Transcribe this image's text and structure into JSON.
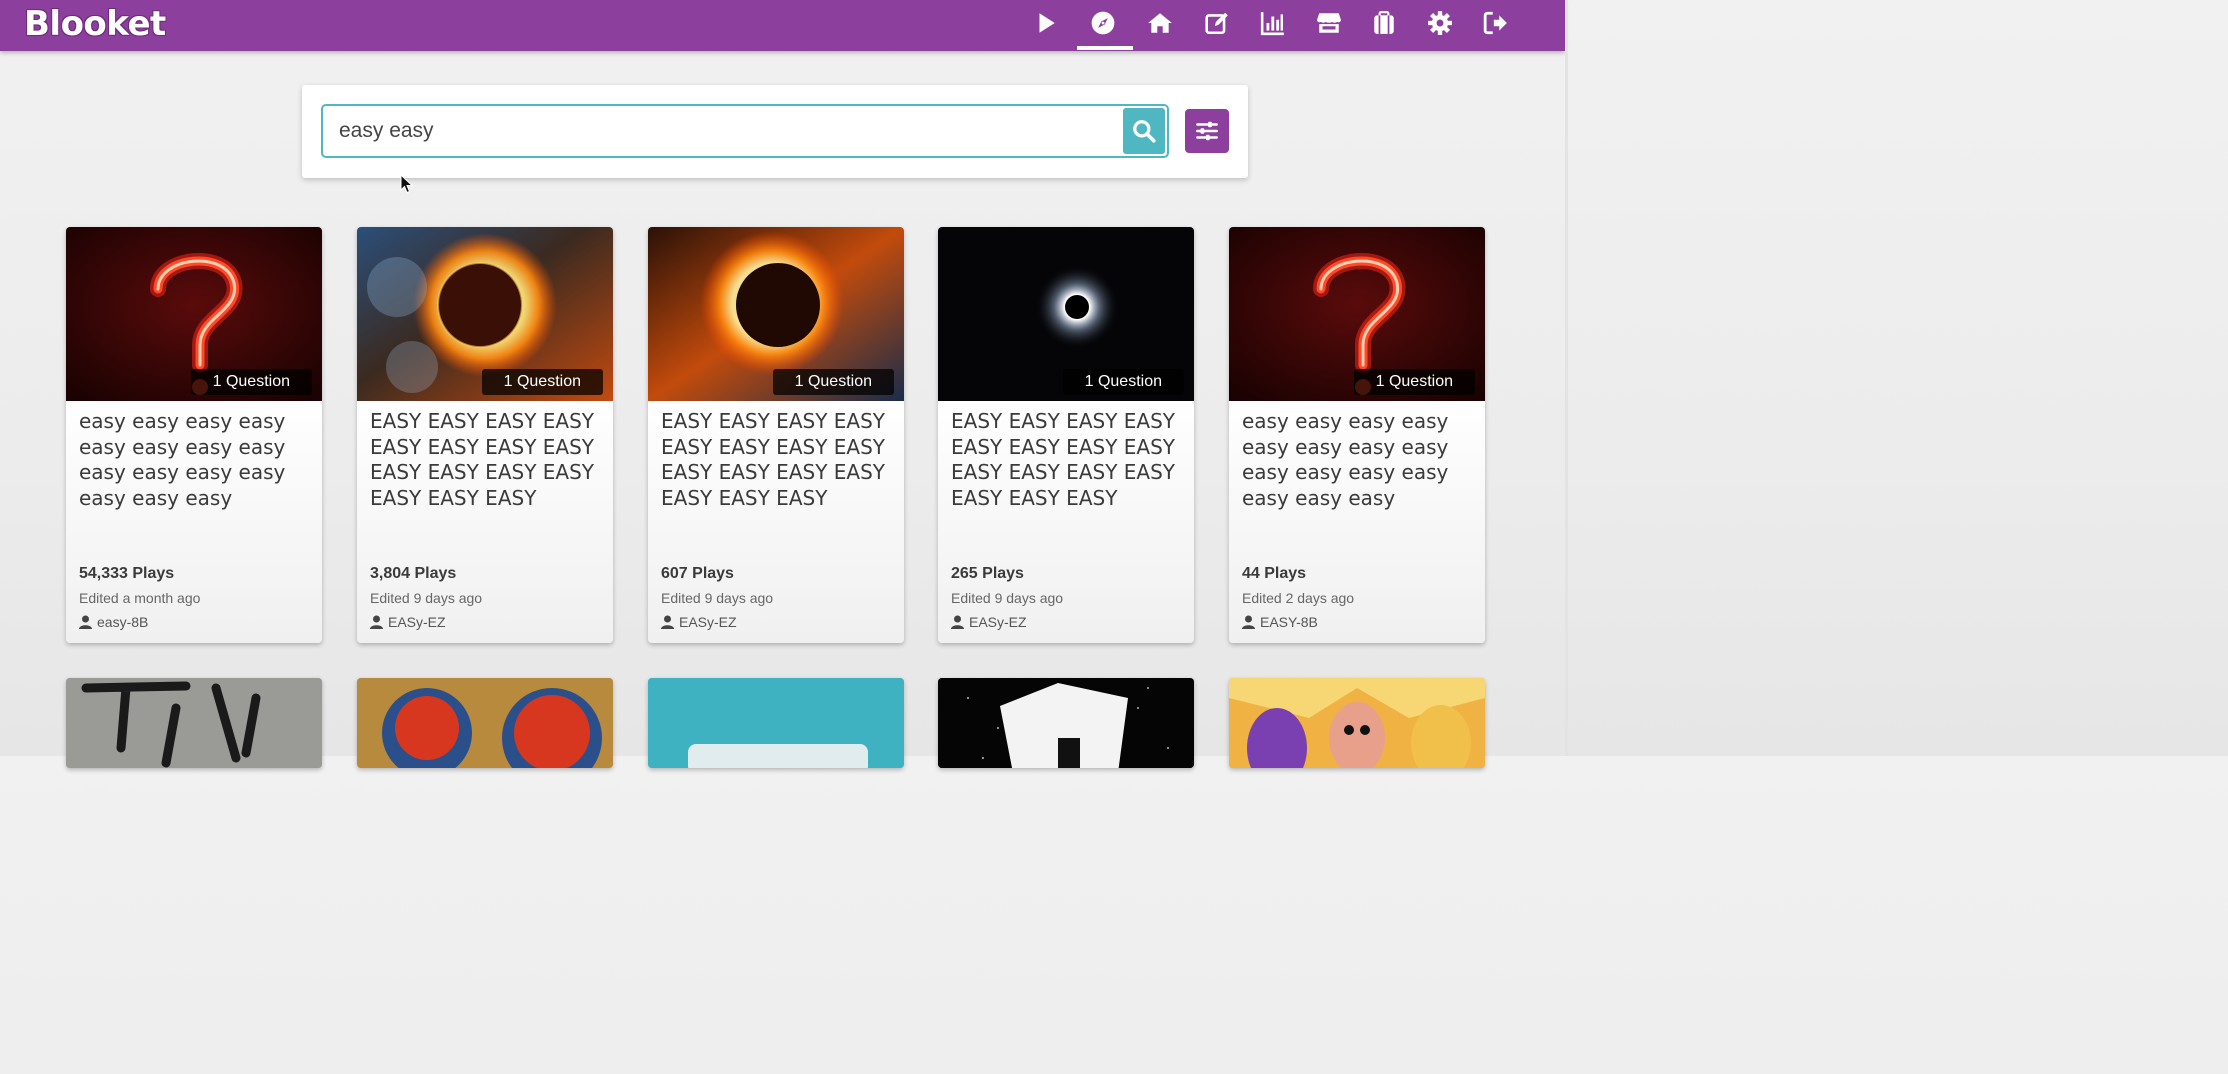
{
  "app": {
    "name": "Blooket"
  },
  "nav": [
    {
      "name": "play-icon"
    },
    {
      "name": "discover-compass-icon"
    },
    {
      "name": "home-icon"
    },
    {
      "name": "edit-icon"
    },
    {
      "name": "stats-chart-icon"
    },
    {
      "name": "market-store-icon"
    },
    {
      "name": "blooks-briefcase-icon"
    },
    {
      "name": "settings-gear-icon"
    },
    {
      "name": "logout-icon"
    }
  ],
  "search": {
    "value": "easy easy"
  },
  "colors": {
    "brand": "#8d3f9e",
    "accent": "#4fb7c2"
  },
  "cards": [
    {
      "badge": "1 Question",
      "title": "easy easy easy easy easy easy easy easy easy easy easy easy easy easy easy",
      "plays": "54,333 Plays",
      "edited": "Edited a month ago",
      "author": "easy-8B",
      "image": "neon-question-mark"
    },
    {
      "badge": "1 Question",
      "title": "EASY EASY EASY EASY EASY EASY EASY EASY EASY EASY EASY EASY EASY EASY EASY",
      "plays": "3,804 Plays",
      "edited": "Edited 9 days ago",
      "author": "EASy-EZ",
      "image": "solar-eclipse-blue"
    },
    {
      "badge": "1 Question",
      "title": "EASY EASY EASY EASY EASY EASY EASY EASY EASY EASY EASY EASY EASY EASY EASY",
      "plays": "607 Plays",
      "edited": "Edited 9 days ago",
      "author": "EASy-EZ",
      "image": "solar-eclipse-orange"
    },
    {
      "badge": "1 Question",
      "title": "EASY EASY EASY EASY EASY EASY EASY EASY EASY EASY EASY EASY EASY EASY EASY",
      "plays": "265 Plays",
      "edited": "Edited 9 days ago",
      "author": "EASy-EZ",
      "image": "eclipse-corona-black"
    },
    {
      "badge": "1 Question",
      "title": "easy easy easy easy easy easy easy easy easy easy easy easy easy easy easy",
      "plays": "44 Plays",
      "edited": "Edited 2 days ago",
      "author": "EASY-8B",
      "image": "neon-question-mark"
    }
  ],
  "second_row": [
    {
      "image": "take-graffiti-wall"
    },
    {
      "image": "easy-buttons"
    },
    {
      "image": "blooket-teal"
    },
    {
      "image": "white-square-stars"
    },
    {
      "image": "fall-guys-characters"
    }
  ]
}
